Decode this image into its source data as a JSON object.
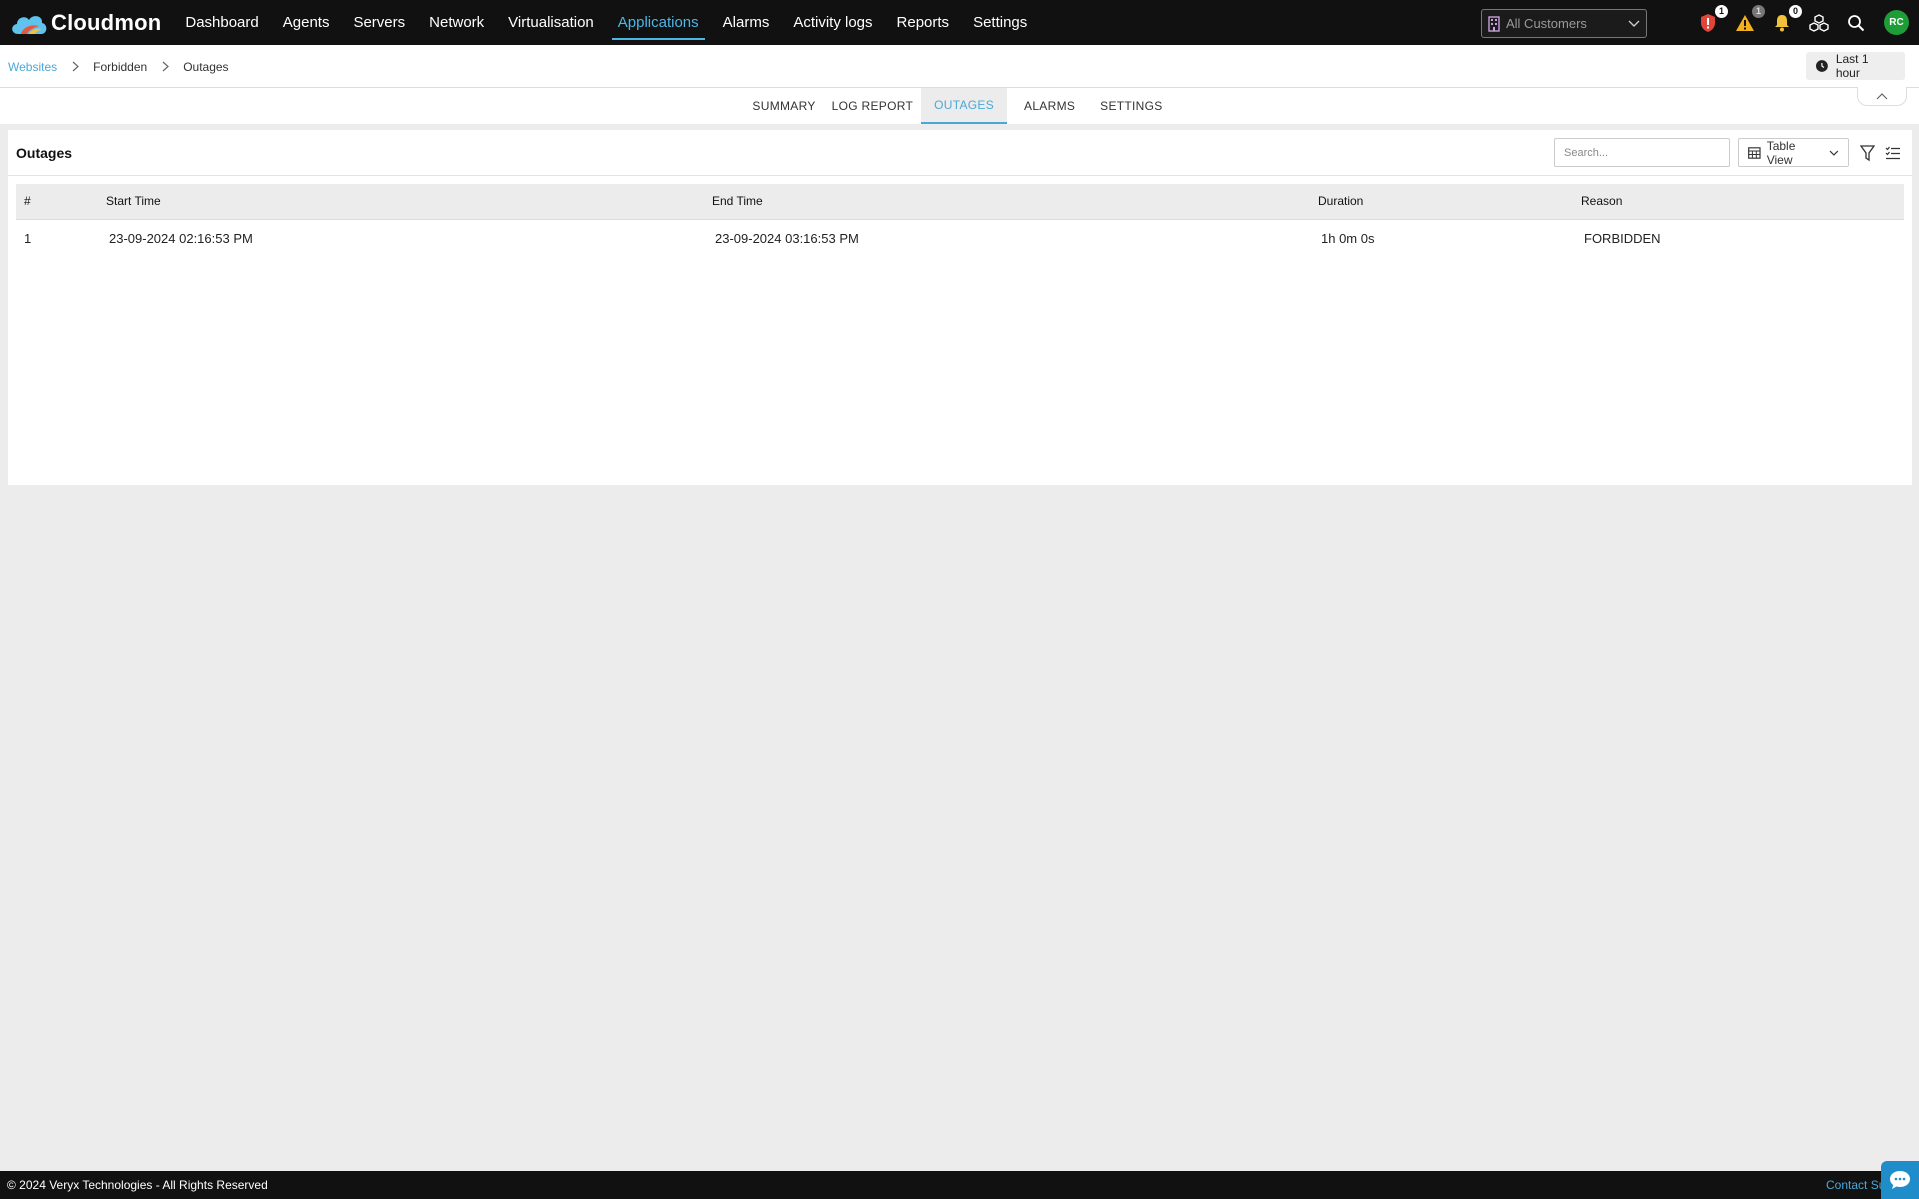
{
  "brand": {
    "name": "Cloudmon"
  },
  "nav": {
    "items": [
      {
        "label": "Dashboard"
      },
      {
        "label": "Agents"
      },
      {
        "label": "Servers"
      },
      {
        "label": "Network"
      },
      {
        "label": "Virtualisation"
      },
      {
        "label": "Applications",
        "active": true
      },
      {
        "label": "Alarms"
      },
      {
        "label": "Activity logs"
      },
      {
        "label": "Reports"
      },
      {
        "label": "Settings"
      }
    ],
    "customer_select": "All Customers",
    "badges": {
      "critical": "1",
      "warning": "1",
      "notifications": "0"
    },
    "avatar_initials": "RC",
    "accent_color": "#4db6e6"
  },
  "breadcrumb": {
    "items": [
      "Websites",
      "Forbidden",
      "Outages"
    ]
  },
  "time_range": "Last 1 hour",
  "subtabs": [
    {
      "label": "SUMMARY"
    },
    {
      "label": "LOG REPORT"
    },
    {
      "label": "OUTAGES",
      "active": true
    },
    {
      "label": "ALARMS"
    },
    {
      "label": "SETTINGS"
    }
  ],
  "panel": {
    "title": "Outages",
    "search_placeholder": "Search...",
    "view_label": "Table View"
  },
  "table": {
    "columns": [
      "#",
      "Start Time",
      "End Time",
      "Duration",
      "Reason"
    ],
    "rows": [
      [
        "1",
        "23-09-2024 02:16:53 PM",
        "23-09-2024 03:16:53 PM",
        "1h 0m 0s",
        "FORBIDDEN"
      ]
    ]
  },
  "footer": {
    "copyright": "© 2024 Veryx Technologies - All Rights Reserved",
    "contact": "Contact Su"
  }
}
